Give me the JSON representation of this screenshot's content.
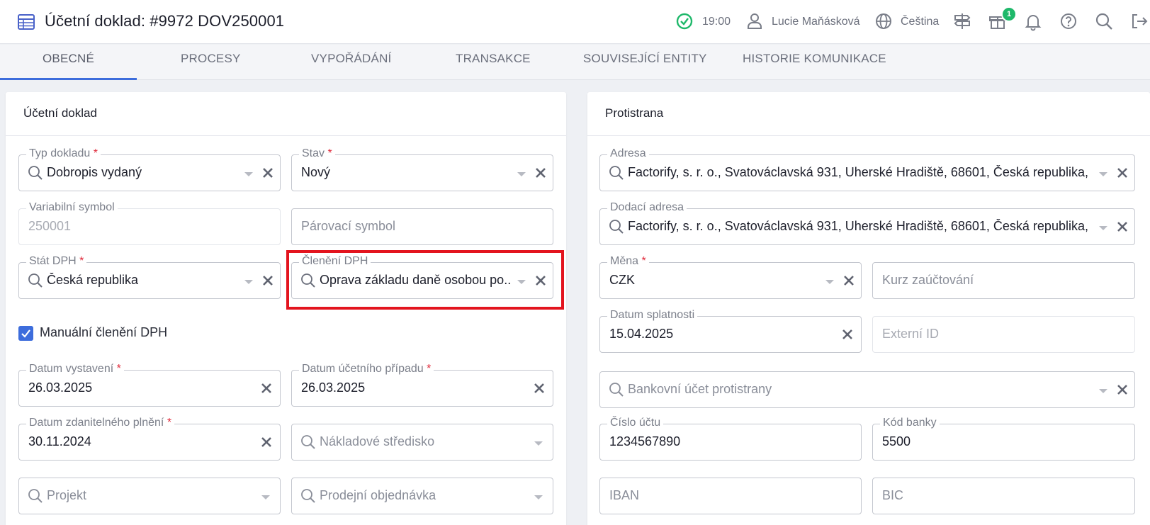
{
  "header": {
    "title": "Účetní doklad: #9972 DOV250001",
    "time": "19:00",
    "user": "Lucie Maňásková",
    "language": "Čeština",
    "gift_badge": "1",
    "icons": [
      "table-icon",
      "check-circle-icon",
      "user-icon",
      "globe-icon",
      "signpost-icon",
      "gift-icon",
      "bell-icon",
      "help-icon",
      "search-icon",
      "logout-icon"
    ]
  },
  "tabs": [
    {
      "label": "OBECNÉ",
      "active": true
    },
    {
      "label": "PROCESY"
    },
    {
      "label": "VYPOŘÁDÁNÍ"
    },
    {
      "label": "TRANSAKCE"
    },
    {
      "label": "SOUVISEJÍCÍ ENTITY"
    },
    {
      "label": "HISTORIE KOMUNIKACE"
    }
  ],
  "left": {
    "title": "Účetní doklad",
    "typ_dokladu": {
      "label": "Typ dokladu",
      "value": "Dobropis vydaný"
    },
    "stav": {
      "label": "Stav",
      "value": "Nový"
    },
    "variabilni_symbol": {
      "label": "Variabilní symbol",
      "value": "250001"
    },
    "parovaci_symbol": {
      "placeholder": "Párovací symbol"
    },
    "stat_dph": {
      "label": "Stát DPH",
      "value": "Česká republika"
    },
    "cleneni_dph": {
      "label": "Členění DPH",
      "value": "Oprava základu daně osobou po..."
    },
    "manualni_cleneni": {
      "label": "Manuální členění DPH",
      "checked": true
    },
    "datum_vystaveni": {
      "label": "Datum vystavení",
      "value": "26.03.2025"
    },
    "datum_ucetniho_pripadu": {
      "label": "Datum účetního případu",
      "value": "26.03.2025"
    },
    "datum_zdanitelneho_plneni": {
      "label": "Datum zdanitelného plnění",
      "value": "30.11.2024"
    },
    "nakladove_stredisko": {
      "placeholder": "Nákladové středisko"
    },
    "projekt": {
      "placeholder": "Projekt"
    },
    "prodejni_objednavka": {
      "placeholder": "Prodejní objednávka"
    }
  },
  "right": {
    "title": "Protistrana",
    "adresa": {
      "label": "Adresa",
      "value": "Factorify, s. r. o., Svatováclavská 931, Uherské Hradiště, 68601, Česká republika, ..."
    },
    "dodaci_adresa": {
      "label": "Dodací adresa",
      "value": "Factorify, s. r. o., Svatováclavská 931, Uherské Hradiště, 68601, Česká republika, ..."
    },
    "mena": {
      "label": "Měna",
      "value": "CZK"
    },
    "kurz": {
      "placeholder": "Kurz zaúčtování"
    },
    "datum_splatnosti": {
      "label": "Datum splatnosti",
      "value": "15.04.2025"
    },
    "externi_id": {
      "placeholder": "Externí ID"
    },
    "bankovni_ucet": {
      "placeholder": "Bankovní účet protistrany"
    },
    "cislo_uctu": {
      "label": "Číslo účtu",
      "value": "1234567890"
    },
    "kod_banky": {
      "label": "Kód banky",
      "value": "5500"
    },
    "iban": {
      "placeholder": "IBAN"
    },
    "bic": {
      "placeholder": "BIC"
    }
  },
  "required_mark": "*",
  "colors": {
    "accent": "#3d6ddc",
    "highlight": "#e3141e",
    "success": "#1eb86a",
    "required": "#e0293a"
  }
}
